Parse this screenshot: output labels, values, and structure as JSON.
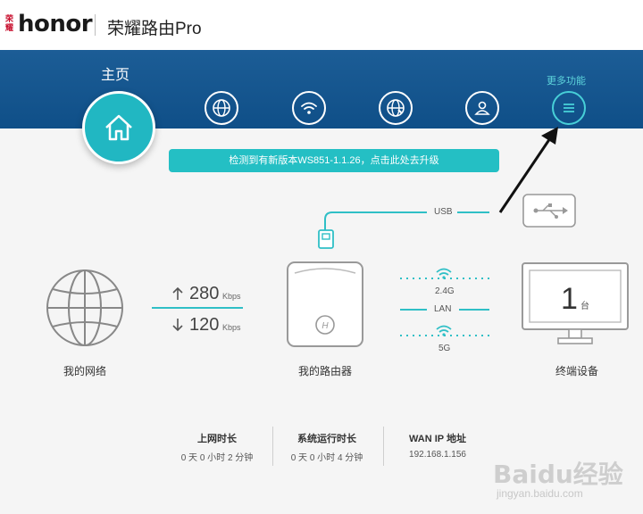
{
  "header": {
    "brand_small": "荣耀",
    "logo": "honor",
    "product_title": "荣耀路由Pro"
  },
  "nav": {
    "home_label": "主页",
    "more_label": "更多功能",
    "items": [
      {
        "icon": "home-icon",
        "active": true
      },
      {
        "icon": "globe-icon"
      },
      {
        "icon": "wifi-icon"
      },
      {
        "icon": "globe-settings-icon"
      },
      {
        "icon": "user-icon"
      },
      {
        "icon": "menu-icon"
      }
    ]
  },
  "banner": {
    "text": "检测到有新版本WS851-1.1.26，点击此处去升级"
  },
  "network": {
    "label": "我的网络",
    "upload_speed": "280",
    "download_speed": "120",
    "unit": "Kbps"
  },
  "router": {
    "label": "我的路由器",
    "usb_label": "USB",
    "band_24": "2.4G",
    "lan_label": "LAN",
    "band_5": "5G"
  },
  "devices": {
    "label": "终端设备",
    "count": "1",
    "unit": "台"
  },
  "stats": [
    {
      "title": "上网时长",
      "value": "0 天 0 小时 2 分钟"
    },
    {
      "title": "系统运行时长",
      "value": "0 天 0 小时 4 分钟"
    },
    {
      "title": "WAN IP 地址",
      "value": "192.168.1.156"
    }
  ],
  "watermark": {
    "text": "Baidu经验",
    "url": "jingyan.baidu.com"
  },
  "colors": {
    "accent": "#21b7c2",
    "nav_band": "#1c5d96",
    "line_teal": "#2fbfc6"
  }
}
